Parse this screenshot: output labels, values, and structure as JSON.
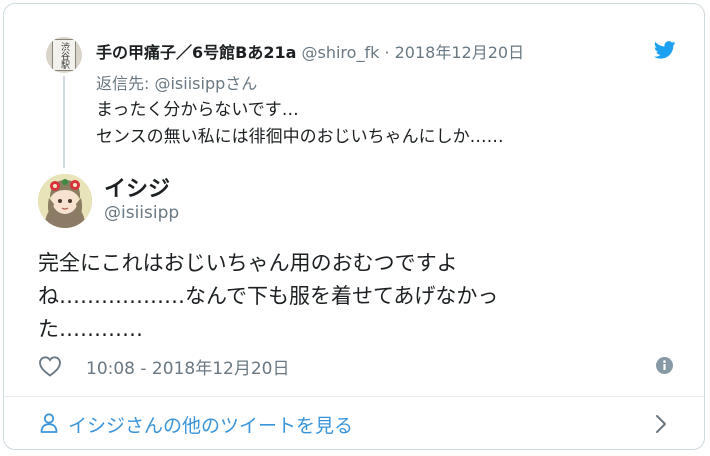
{
  "parent_tweet": {
    "avatar_text": "渋谷駅",
    "display_name": "手の甲痛子／6号館Bあ21a",
    "handle": "@shiro_fk",
    "separator": "·",
    "date": "2018年12月20日",
    "reply_prefix": "返信先: ",
    "reply_mention": "@isiisipp",
    "reply_suffix": "さん",
    "text_lines": [
      "まったく分からないです…",
      "センスの無い私には徘徊中のおじいちゃんにしか……"
    ]
  },
  "main_tweet": {
    "display_name": "イシジ",
    "handle": "@isiisipp",
    "text_lines": [
      "完全にこれはおじいちゃん用のおむつですよ",
      "ね………………なんで下も服を着せてあげなかっ",
      "た…………"
    ],
    "timestamp": "10:08 - 2018年12月20日"
  },
  "footer": {
    "more_link_label": "イシジさんの他のツイートを見る"
  },
  "icons": {
    "brand": "twitter-bird-icon",
    "like": "heart-icon",
    "info": "info-icon",
    "person": "person-icon",
    "chevron": "chevron-right-icon"
  },
  "colors": {
    "twitter_blue": "#1da1f2",
    "link_blue": "#3b94d9",
    "secondary_text": "#697882",
    "primary_text": "#1c2022"
  }
}
